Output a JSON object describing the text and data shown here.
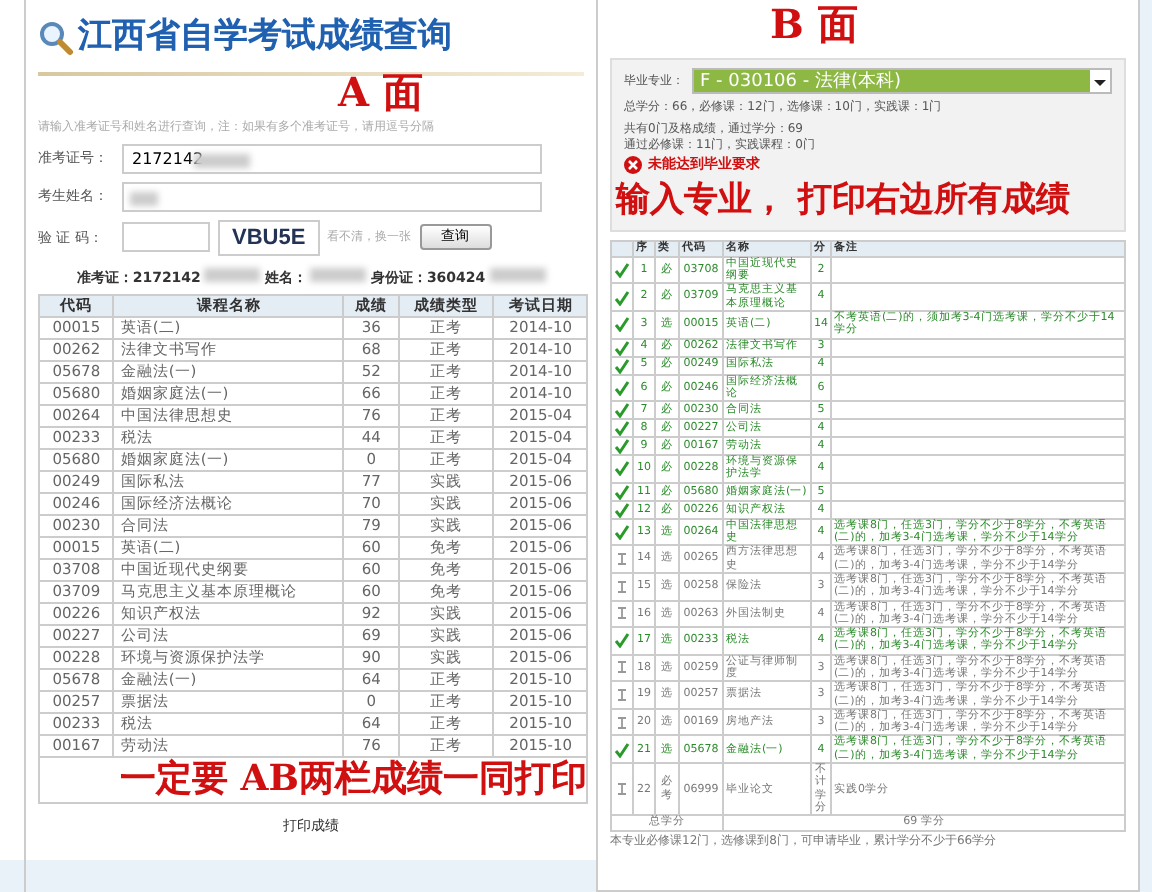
{
  "title": "江西省自学考试成绩查询",
  "panel_a": {
    "label": "A 面",
    "hint": "请输入准考证号和姓名进行查询，注：如果有多个准考证号，请用逗号分隔",
    "form": [
      {
        "kind": "text",
        "label": "准考证号：",
        "value": "2172142"
      },
      {
        "kind": "text",
        "label": "考生姓名："
      },
      {
        "kind": "captcha",
        "label": "验 证 码：",
        "captcha": "VBU5E",
        "refresh": "看不清，换一张",
        "button": "查询"
      }
    ],
    "summary": [
      "准考证：2172142",
      "姓名：",
      "身份证：360424"
    ],
    "columns": [
      "代码",
      "课程名称",
      "成绩",
      "成绩类型",
      "考试日期"
    ],
    "rows": [
      [
        "00015",
        "英语(二)",
        "36",
        "正考",
        "2014-10"
      ],
      [
        "00262",
        "法律文书写作",
        "68",
        "正考",
        "2014-10"
      ],
      [
        "05678",
        "金融法(一)",
        "52",
        "正考",
        "2014-10"
      ],
      [
        "05680",
        "婚姻家庭法(一)",
        "66",
        "正考",
        "2014-10"
      ],
      [
        "00264",
        "中国法律思想史",
        "76",
        "正考",
        "2015-04"
      ],
      [
        "00233",
        "税法",
        "44",
        "正考",
        "2015-04"
      ],
      [
        "05680",
        "婚姻家庭法(一)",
        "0",
        "正考",
        "2015-04"
      ],
      [
        "00249",
        "国际私法",
        "77",
        "实践",
        "2015-06"
      ],
      [
        "00246",
        "国际经济法概论",
        "70",
        "实践",
        "2015-06"
      ],
      [
        "00230",
        "合同法",
        "79",
        "实践",
        "2015-06"
      ],
      [
        "00015",
        "英语(二)",
        "60",
        "免考",
        "2015-06"
      ],
      [
        "03708",
        "中国近现代史纲要",
        "60",
        "免考",
        "2015-06"
      ],
      [
        "03709",
        "马克思主义基本原理概论",
        "60",
        "免考",
        "2015-06"
      ],
      [
        "00226",
        "知识产权法",
        "92",
        "实践",
        "2015-06"
      ],
      [
        "00227",
        "公司法",
        "69",
        "实践",
        "2015-06"
      ],
      [
        "00228",
        "环境与资源保护法学",
        "90",
        "实践",
        "2015-06"
      ],
      [
        "05678",
        "金融法(一)",
        "64",
        "正考",
        "2015-10"
      ],
      [
        "00257",
        "票据法",
        "0",
        "正考",
        "2015-10"
      ],
      [
        "00233",
        "税法",
        "64",
        "正考",
        "2015-10"
      ],
      [
        "00167",
        "劳动法",
        "76",
        "正考",
        "2015-10"
      ]
    ],
    "note": "一定要 AB两栏成绩一同打印",
    "print_link": "打印成绩"
  },
  "panel_b": {
    "label": "B 面",
    "major_label": "毕业专业：",
    "major": "F - 030106 - 法律(本科)",
    "requirements": "总学分：66，必修课：12门，选修课：10门，实践课：1门",
    "progress": [
      "共有0门及格成绩，通过学分：69",
      "通过必修课：11门，实践课程：0门"
    ],
    "status": "未能达到毕业要求",
    "note": "输入专业， 打印右边所有成绩",
    "columns": [
      "序",
      "类",
      "代码",
      "名称",
      "分",
      "备注"
    ],
    "rows": [
      {
        "passed": true,
        "no": "1",
        "category": "必",
        "code": "03708",
        "name": "中国近现代史纲要",
        "credits": "2"
      },
      {
        "passed": true,
        "no": "2",
        "category": "必",
        "code": "03709",
        "name": "马克思主义基本原理概论",
        "credits": "4"
      },
      {
        "passed": true,
        "no": "3",
        "category": "选",
        "code": "00015",
        "name": "英语(二)",
        "credits": "14",
        "remark": "不考英语(二)的，须加考3-4门选考课，学分不少于14学分"
      },
      {
        "passed": true,
        "no": "4",
        "category": "必",
        "code": "00262",
        "name": "法律文书写作",
        "credits": "3"
      },
      {
        "passed": true,
        "no": "5",
        "category": "必",
        "code": "00249",
        "name": "国际私法",
        "credits": "4"
      },
      {
        "passed": true,
        "no": "6",
        "category": "必",
        "code": "00246",
        "name": "国际经济法概论",
        "credits": "6"
      },
      {
        "passed": true,
        "no": "7",
        "category": "必",
        "code": "00230",
        "name": "合同法",
        "credits": "5"
      },
      {
        "passed": true,
        "no": "8",
        "category": "必",
        "code": "00227",
        "name": "公司法",
        "credits": "4"
      },
      {
        "passed": true,
        "no": "9",
        "category": "必",
        "code": "00167",
        "name": "劳动法",
        "credits": "4"
      },
      {
        "passed": true,
        "no": "10",
        "category": "必",
        "code": "00228",
        "name": "环境与资源保护法学",
        "credits": "4"
      },
      {
        "passed": true,
        "no": "11",
        "category": "必",
        "code": "05680",
        "name": "婚姻家庭法(一)",
        "credits": "5"
      },
      {
        "passed": true,
        "no": "12",
        "category": "必",
        "code": "00226",
        "name": "知识产权法",
        "credits": "4"
      },
      {
        "passed": true,
        "no": "13",
        "category": "选",
        "code": "00264",
        "name": "中国法律思想史",
        "credits": "4",
        "remark": "选考课8门，任选3门，学分不少于8学分，不考英语(二)的，加考3-4门选考课，学分不少于14学分"
      },
      {
        "passed": false,
        "no": "14",
        "category": "选",
        "code": "00265",
        "name": "西方法律思想史",
        "credits": "4",
        "remark": "选考课8门，任选3门，学分不少于8学分，不考英语(二)的，加考3-4门选考课，学分不少于14学分"
      },
      {
        "passed": false,
        "no": "15",
        "category": "选",
        "code": "00258",
        "name": "保险法",
        "credits": "3",
        "remark": "选考课8门，任选3门，学分不少于8学分，不考英语(二)的，加考3-4门选考课，学分不少于14学分"
      },
      {
        "passed": false,
        "no": "16",
        "category": "选",
        "code": "00263",
        "name": "外国法制史",
        "credits": "4",
        "remark": "选考课8门，任选3门，学分不少于8学分，不考英语(二)的，加考3-4门选考课，学分不少于14学分"
      },
      {
        "passed": true,
        "no": "17",
        "category": "选",
        "code": "00233",
        "name": "税法",
        "credits": "4",
        "remark": "选考课8门，任选3门，学分不少于8学分，不考英语(二)的，加考3-4门选考课，学分不少于14学分"
      },
      {
        "passed": false,
        "no": "18",
        "category": "选",
        "code": "00259",
        "name": "公证与律师制度",
        "credits": "3",
        "remark": "选考课8门，任选3门，学分不少于8学分，不考英语(二)的，加考3-4门选考课，学分不少于14学分"
      },
      {
        "passed": false,
        "no": "19",
        "category": "选",
        "code": "00257",
        "name": "票据法",
        "credits": "3",
        "remark": "选考课8门，任选3门，学分不少于8学分，不考英语(二)的，加考3-4门选考课，学分不少于14学分"
      },
      {
        "passed": false,
        "no": "20",
        "category": "选",
        "code": "00169",
        "name": "房地产法",
        "credits": "3",
        "remark": "选考课8门，任选3门，学分不少于8学分，不考英语(二)的，加考3-4门选考课，学分不少于14学分"
      },
      {
        "passed": true,
        "no": "21",
        "category": "选",
        "code": "05678",
        "name": "金融法(一)",
        "credits": "4",
        "remark": "选考课8门，任选3门，学分不少于8学分，不考英语(二)的，加考3-4门选考课，学分不少于14学分"
      },
      {
        "passed": false,
        "no": "22",
        "category": "必考",
        "code": "06999",
        "name": "毕业论文",
        "credits": "不计学分",
        "remark": "实践0学分"
      }
    ],
    "total_label": "总学分",
    "total": "69 学分",
    "footer": "本专业必修课12门，选修课到8门，可申请毕业，累计学分不少于66学分"
  }
}
